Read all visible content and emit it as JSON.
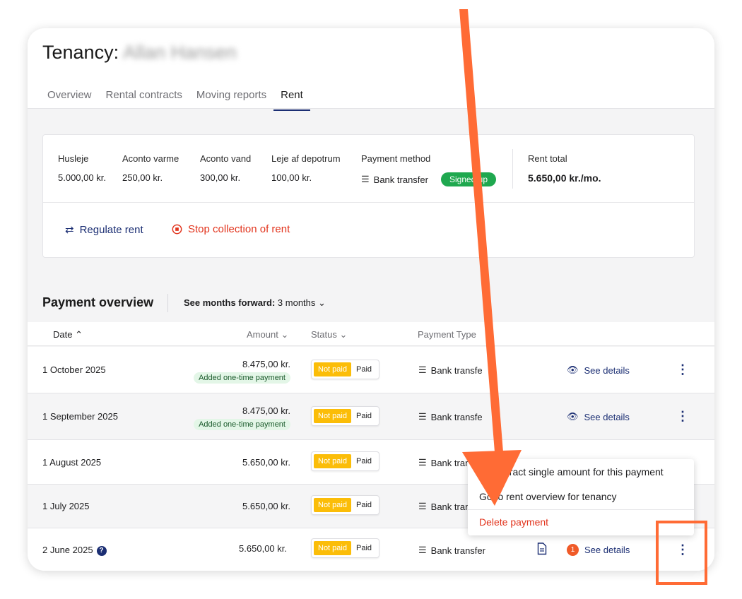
{
  "header": {
    "title_prefix": "Tenancy:",
    "tenant_name": "Allan Hansen"
  },
  "tabs": [
    {
      "label": "Overview"
    },
    {
      "label": "Rental contracts"
    },
    {
      "label": "Moving reports"
    },
    {
      "label": "Rent",
      "active": true
    }
  ],
  "summary": {
    "items": [
      {
        "label": "Husleje",
        "value": "5.000,00 kr."
      },
      {
        "label": "Aconto varme",
        "value": "250,00 kr."
      },
      {
        "label": "Aconto vand",
        "value": "300,00 kr."
      },
      {
        "label": "Leje af depotrum",
        "value": "100,00 kr."
      }
    ],
    "payment_method": {
      "label": "Payment method",
      "value": "Bank transfer",
      "badge": "Signed up"
    },
    "rent_total": {
      "label": "Rent total",
      "value": "5.650,00 kr./mo."
    },
    "actions": {
      "regulate": "Regulate rent",
      "stop": "Stop collection of rent"
    }
  },
  "payment_overview": {
    "title": "Payment overview",
    "months_label": "See months forward:",
    "months_value": "3 months",
    "columns": {
      "date": "Date",
      "amount": "Amount",
      "status": "Status",
      "payment_type": "Payment Type"
    },
    "status_labels": {
      "not_paid": "Not paid",
      "paid": "Paid"
    },
    "see_details": "See details",
    "rows": [
      {
        "date": "1 October 2025",
        "amount": "8.475,00 kr.",
        "badge": "Added one-time payment",
        "payment_type": "Bank transfer"
      },
      {
        "date": "1 September 2025",
        "amount": "8.475,00 kr.",
        "badge": "Added one-time payment",
        "payment_type": "Bank transfer"
      },
      {
        "date": "1 August 2025",
        "amount": "5.650,00 kr.",
        "payment_type": "Bank transfer"
      },
      {
        "date": "1 July 2025",
        "amount": "5.650,00 kr.",
        "payment_type": "Bank transfer"
      },
      {
        "date": "2 June 2025",
        "amount": "5.650,00 kr.",
        "payment_type": "Bank transfer",
        "notification_count": "1"
      }
    ]
  },
  "context_menu": {
    "items": [
      {
        "label": "Subtract single amount for this payment"
      },
      {
        "label": "Go to rent overview for tenancy"
      },
      {
        "label": "Delete payment",
        "danger": true
      }
    ]
  },
  "colors": {
    "brand_navy": "#1b2e73",
    "danger": "#e2341d",
    "not_paid": "#fbbd08",
    "signed_up": "#1fa84f",
    "annotation": "#ff6b35"
  }
}
